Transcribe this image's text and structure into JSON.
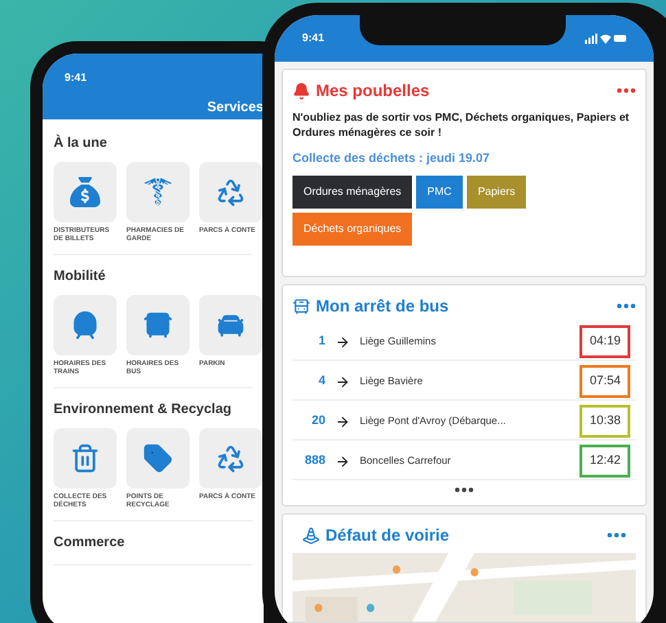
{
  "left_phone": {
    "time": "9:41",
    "title": "Services",
    "sections": [
      {
        "heading": "À la une",
        "tiles": [
          {
            "kind": "money",
            "label": "DISTRIBUTEURS DE BILLETS"
          },
          {
            "kind": "pharmacy",
            "label": "PHARMACIES DE GARDE"
          },
          {
            "kind": "recycle",
            "label": "PARCS À CONTE"
          }
        ]
      },
      {
        "heading": "Mobilité",
        "tiles": [
          {
            "kind": "train",
            "label": "HORAIRES DES TRAINS"
          },
          {
            "kind": "bus",
            "label": "HORAIRES DES BUS"
          },
          {
            "kind": "car",
            "label": "PARKIN"
          }
        ]
      },
      {
        "heading": "Environnement & Recyclag",
        "tiles": [
          {
            "kind": "trash",
            "label": "COLLECTE DES DÉCHETS"
          },
          {
            "kind": "tag",
            "label": "POINTS DE RECYCLAGE"
          },
          {
            "kind": "recycle",
            "label": "PARCS À CONTE"
          }
        ]
      },
      {
        "heading": "Commerce"
      }
    ]
  },
  "right_phone": {
    "time": "9:41",
    "waste": {
      "title": "Mes poubelles",
      "message": "N'oubliez pas de sortir vos PMC, Déchets organiques, Papiers et Ordures ménagères ce soir !",
      "collection": "Collecte des déchets : jeudi 19.07",
      "tags": [
        {
          "label": "Ordures ménagères",
          "color": "#2b2d30"
        },
        {
          "label": "PMC",
          "color": "#1f7fd1"
        },
        {
          "label": "Papiers",
          "color": "#a8902c"
        },
        {
          "label": "Déchets organiques",
          "color": "#f07020"
        }
      ]
    },
    "bus": {
      "title": "Mon arrêt de bus",
      "departures": [
        {
          "line": "1",
          "destination": "Liège Guillemins",
          "time": "04:19",
          "color": "#e03a3a"
        },
        {
          "line": "4",
          "destination": "Liège Bavière",
          "time": "07:54",
          "color": "#ee7a22"
        },
        {
          "line": "20",
          "destination": "Liège Pont d'Avroy (Débarque...",
          "time": "10:38",
          "color": "#b6c12e"
        },
        {
          "line": "888",
          "destination": "Boncelles Carrefour",
          "time": "12:42",
          "color": "#4caf50"
        }
      ]
    },
    "road": {
      "title": "Défaut de voirie"
    }
  }
}
